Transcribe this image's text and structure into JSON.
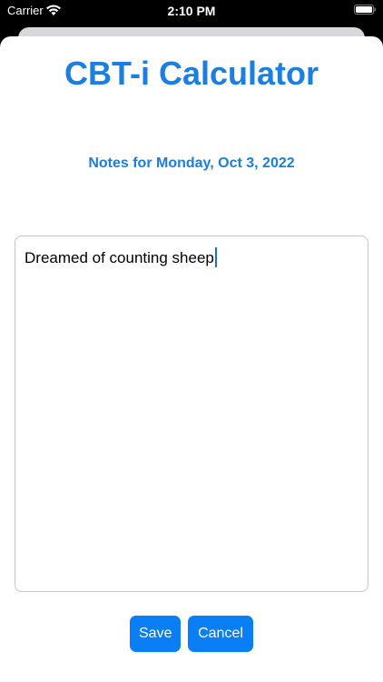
{
  "status_bar": {
    "carrier": "Carrier",
    "time": "2:10 PM",
    "wifi_icon": "wifi-icon",
    "battery_icon": "battery-icon"
  },
  "app": {
    "title": "CBT-i Calculator",
    "subtitle": "Notes for Monday, Oct 3, 2022"
  },
  "notes": {
    "value": "Dreamed of counting sheep"
  },
  "buttons": {
    "save_label": "Save",
    "cancel_label": "Cancel"
  },
  "colors": {
    "accent": "#1a7fe0",
    "button": "#0a7ff5"
  }
}
